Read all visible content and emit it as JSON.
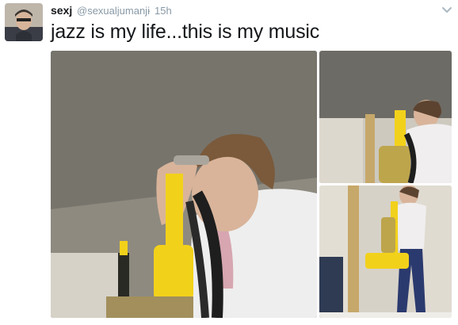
{
  "tweet": {
    "author": {
      "display_name": "sexj",
      "handle": "@sexualjumanji",
      "separator": "·",
      "timestamp": "15h"
    },
    "text": "jazz is my life...this is my music",
    "menu_icon": "chevron-down-icon",
    "media": [
      {
        "name": "photo-main"
      },
      {
        "name": "photo-top-right"
      },
      {
        "name": "photo-bottom-right"
      }
    ]
  },
  "colors": {
    "name": "#14171a",
    "meta": "#8899a6",
    "vacuum_yellow": "#f2d11b",
    "hose": "#1e1e1e"
  }
}
